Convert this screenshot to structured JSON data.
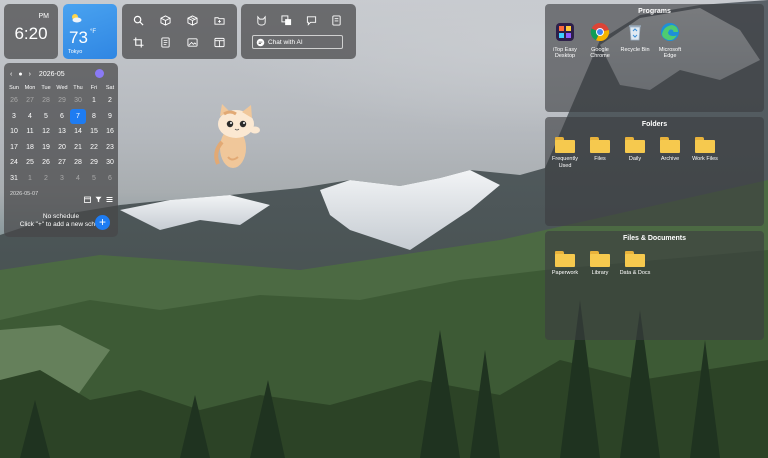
{
  "clock": {
    "ampm": "PM",
    "time": "6:20"
  },
  "weather": {
    "temp": "73",
    "unit": "°F",
    "city": "Tokyo",
    "icon": "partly-cloudy-icon"
  },
  "toolbar1": {
    "icons": [
      "search-icon",
      "cube-icon",
      "box-icon",
      "folder-plus-icon",
      "crop-icon",
      "document-icon",
      "image-icon",
      "window-icon"
    ]
  },
  "toolbar2": {
    "icons": [
      "cat-icon",
      "copy-icon",
      "chat-bubble-icon",
      "note-icon"
    ],
    "chat_label": "Chat with AI"
  },
  "calendar": {
    "month": "2026-05",
    "weekdays": [
      "Sun",
      "Mon",
      "Tue",
      "Wed",
      "Thu",
      "Fri",
      "Sat"
    ],
    "days": [
      "26",
      "27",
      "28",
      "29",
      "30",
      "1",
      "2",
      "3",
      "4",
      "5",
      "6",
      "7",
      "8",
      "9",
      "10",
      "11",
      "12",
      "13",
      "14",
      "15",
      "16",
      "17",
      "18",
      "19",
      "20",
      "21",
      "22",
      "23",
      "24",
      "25",
      "26",
      "27",
      "28",
      "29",
      "30",
      "31",
      "1",
      "2",
      "3",
      "4",
      "5",
      "6"
    ],
    "dim_indices": [
      0,
      1,
      2,
      3,
      4,
      36,
      37,
      38,
      39,
      40,
      41
    ],
    "today_index": 11,
    "selected_date": "2026-05-07",
    "no_schedule": "No schedule",
    "hint": "Click \"+\" to add a new sched",
    "add_label": "+"
  },
  "fences": {
    "programs": {
      "title": "Programs",
      "items": [
        "iTop Easy Desktop",
        "Google Chrome",
        "Recycle Bin",
        "Microsoft Edge"
      ]
    },
    "folders": {
      "title": "Folders",
      "items": [
        "Frequently Used",
        "Files",
        "Daily",
        "Archive",
        "Work Files"
      ]
    },
    "files": {
      "title": "Files & Documents",
      "items": [
        "Paperwork",
        "Library",
        "Data & Docs"
      ]
    }
  },
  "colors": {
    "accent": "#1e7cf2",
    "folder": "#f6c94e",
    "panel": "#464648"
  }
}
